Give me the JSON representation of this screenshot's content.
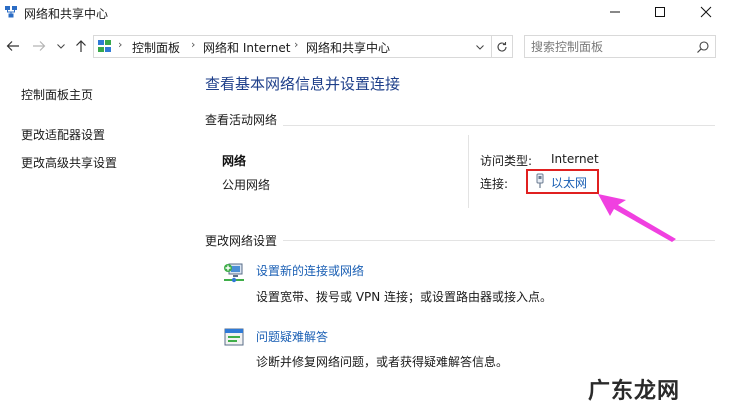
{
  "window": {
    "title": "网络和共享中心",
    "icons": {
      "app": "network-sharing-icon",
      "minimize": "minimize-icon",
      "maximize": "maximize-icon",
      "close": "close-icon"
    }
  },
  "nav": {
    "breadcrumbs": [
      "控制面板",
      "网络和 Internet",
      "网络和共享中心"
    ],
    "search_placeholder": "搜索控制面板"
  },
  "sidebar": {
    "items": [
      {
        "label": "控制面板主页"
      },
      {
        "label": "更改适配器设置"
      },
      {
        "label": "更改高级共享设置"
      }
    ]
  },
  "main": {
    "title": "查看基本网络信息并设置连接",
    "active_section": "查看活动网络",
    "network": {
      "name": "网络",
      "type": "公用网络",
      "access_label": "访问类型:",
      "access_value": "Internet",
      "connection_label": "连接:",
      "connection_value": "以太网"
    },
    "change_section": "更改网络设置",
    "tasks": [
      {
        "icon": "new-connection-icon",
        "title": "设置新的连接或网络",
        "desc": "设置宽带、拨号或 VPN 连接；或设置路由器或接入点。"
      },
      {
        "icon": "troubleshoot-icon",
        "title": "问题疑难解答",
        "desc": "诊断并修复网络问题，或者获得疑难解答信息。"
      }
    ]
  },
  "annotation": {
    "highlight_color": "#e02020",
    "arrow_color": "#f040e0"
  },
  "watermark": "广东龙网"
}
